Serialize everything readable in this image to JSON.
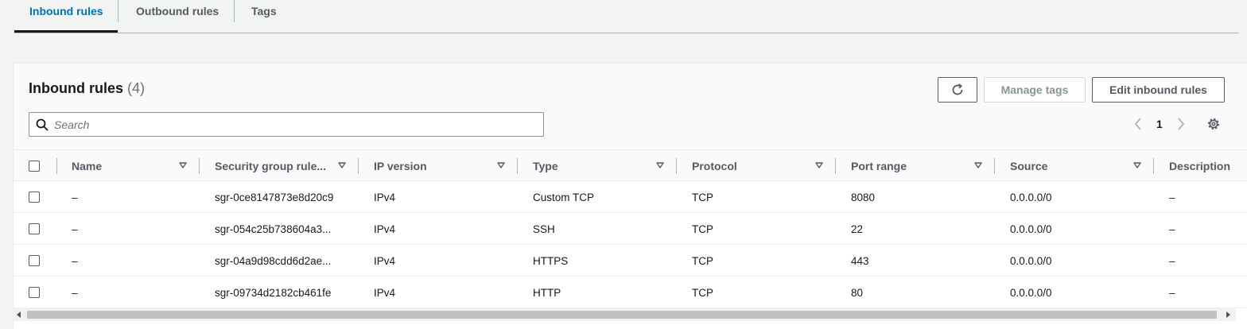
{
  "tabs": [
    {
      "label": "Inbound rules",
      "active": true
    },
    {
      "label": "Outbound rules",
      "active": false
    },
    {
      "label": "Tags",
      "active": false
    }
  ],
  "panel": {
    "title": "Inbound rules",
    "count": "(4)",
    "buttons": {
      "refresh_icon": "refresh-icon",
      "manage_tags": "Manage tags",
      "edit_inbound": "Edit inbound rules"
    },
    "search": {
      "placeholder": "Search",
      "value": ""
    },
    "pagination": {
      "current_page": "1"
    }
  },
  "table": {
    "columns": [
      "Name",
      "Security group rule...",
      "IP version",
      "Type",
      "Protocol",
      "Port range",
      "Source",
      "Description"
    ],
    "rows": [
      {
        "name": "–",
        "rule_id": "sgr-0ce8147873e8d20c9",
        "ip_version": "IPv4",
        "type": "Custom TCP",
        "protocol": "TCP",
        "port_range": "8080",
        "source": "0.0.0.0/0",
        "description": "–"
      },
      {
        "name": "–",
        "rule_id": "sgr-054c25b738604a3...",
        "ip_version": "IPv4",
        "type": "SSH",
        "protocol": "TCP",
        "port_range": "22",
        "source": "0.0.0.0/0",
        "description": "–"
      },
      {
        "name": "–",
        "rule_id": "sgr-04a9d98cdd6d2ae...",
        "ip_version": "IPv4",
        "type": "HTTPS",
        "protocol": "TCP",
        "port_range": "443",
        "source": "0.0.0.0/0",
        "description": "–"
      },
      {
        "name": "–",
        "rule_id": "sgr-09734d2182cb461fe",
        "ip_version": "IPv4",
        "type": "HTTP",
        "protocol": "TCP",
        "port_range": "80",
        "source": "0.0.0.0/0",
        "description": "–"
      }
    ]
  },
  "colors": {
    "accent": "#0073bb",
    "text": "#16191f",
    "muted": "#545b64"
  }
}
